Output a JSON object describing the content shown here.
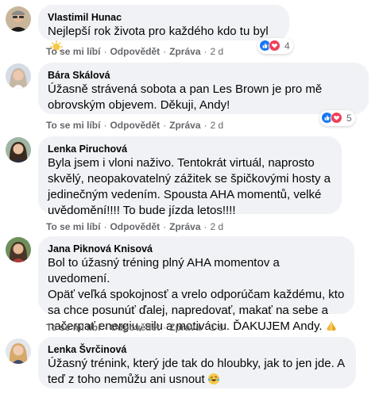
{
  "actions": {
    "like": "To se mi líbí",
    "reply": "Odpovědět",
    "share": "Zpráva",
    "separator": "·"
  },
  "comments": [
    {
      "author": "Vlastimil Hunac",
      "text": "Nejlepší rok života pro každého kdo tu byl",
      "emoji": "sun-emoji",
      "time": "2 d",
      "reaction_count": "4",
      "reactions": [
        "like-reaction",
        "love-reaction"
      ]
    },
    {
      "author": "Bára Skálová",
      "text": "Úžasně strávená sobota a pan Les Brown je pro mě\nobrovským objevem. Děkuji, Andy!",
      "time": "2 d",
      "reaction_count": "5",
      "reactions": [
        "like-reaction",
        "love-reaction"
      ]
    },
    {
      "author": "Lenka Piruchová",
      "text": "Byla jsem i vloni naživo. Tentokrát virtuál, naprosto\nskvělý, neopakovatelný zážitek se špičkovými hosty a\njedinečným vedením. Spousta AHA momentů, velké\nuvědomění!!!! To bude jízda letos!!!!",
      "time": "2 d"
    },
    {
      "author": "Jana Piknová Knisová",
      "text": "Bol to úžasný tréning plný AHA momentov a uvedomení.\nOpäť veľká spokojnosť a vrelo odporúčam každému, kto\nsa chce posunúť ďalej, napredovať, makať na sebe a\nnačerpať energiu, silu a motiváciu. ĎAKUJEM Andy.",
      "emoji": "folded-hands-emoji",
      "time": "1 d"
    },
    {
      "author": "Lenka Švrčinová",
      "text": "Úžasný trénink, který jde tak do hloubky, jak to jen jde. A\nteď z toho nemůžu ani usnout",
      "emoji": "rofl-emoji"
    }
  ]
}
